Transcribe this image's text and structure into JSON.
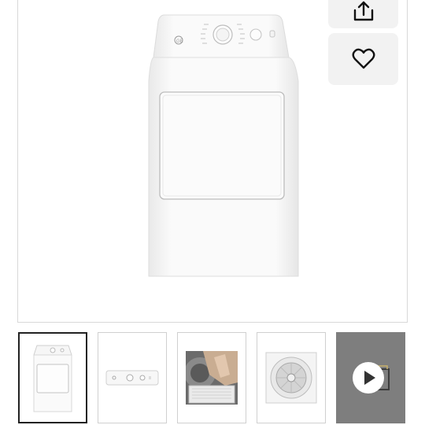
{
  "gallery": {
    "main_image": {
      "icon": "dryer-front-image"
    },
    "actions": [
      {
        "id": "share",
        "icon": "share-icon"
      },
      {
        "id": "favorite",
        "icon": "heart-icon"
      }
    ],
    "thumbnails": [
      {
        "icon": "dryer-front-thumbnail",
        "selected": true
      },
      {
        "icon": "control-panel-thumbnail",
        "selected": false
      },
      {
        "icon": "lint-filter-thumbnail",
        "selected": false
      },
      {
        "icon": "dryer-drum-thumbnail",
        "selected": false
      },
      {
        "icon": "play-video-icon",
        "selected": false
      }
    ]
  },
  "colors": {
    "appliance": "#ffffff",
    "button_bg": "#f2f2f2",
    "selected_border": "#222222",
    "video_bg": "#7e7e7e"
  }
}
